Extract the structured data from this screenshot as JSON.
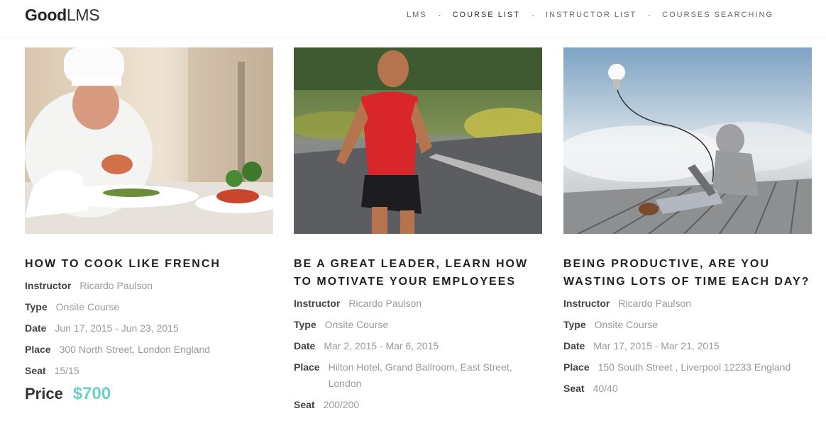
{
  "brand": {
    "strong": "Good",
    "light": "LMS"
  },
  "nav": {
    "items": [
      {
        "label": "LMS"
      },
      {
        "label": "COURSE LIST"
      },
      {
        "label": "INSTRUCTOR LIST"
      },
      {
        "label": "COURSES SEARCHING"
      }
    ],
    "separator": "·"
  },
  "labels": {
    "instructor": "Instructor",
    "type": "Type",
    "date": "Date",
    "place": "Place",
    "seat": "Seat",
    "price": "Price"
  },
  "courses": [
    {
      "title": "HOW TO COOK LIKE FRENCH",
      "image": "chef-plating-food-photo",
      "instructor": "Ricardo Paulson",
      "type": "Onsite Course",
      "date": "Jun 17, 2015 - Jun 23, 2015",
      "place": "300 North Street, London England",
      "seat": "15/15",
      "price": "$700"
    },
    {
      "title": "BE A GREAT LEADER, LEARN HOW TO MOTIVATE YOUR EMPLOYEES",
      "image": "runner-on-road-photo",
      "instructor": "Ricardo Paulson",
      "type": "Onsite Course",
      "date": "Mar 2, 2015 - Mar 6, 2015",
      "place": "Hilton Hotel, Grand Ballroom, East Street, London",
      "seat": "200/200"
    },
    {
      "title": "BEING PRODUCTIVE, ARE YOU WASTING LOTS OF TIME EACH DAY?",
      "image": "man-with-laptop-lightbulb-photo",
      "instructor": "Ricardo Paulson",
      "type": "Onsite Course",
      "date": "Mar 17, 2015 - Mar 21, 2015",
      "place": "150 South Street , Liverpool 12233 England",
      "seat": "40/40"
    }
  ],
  "colors": {
    "accent": "#6ccfc8"
  }
}
